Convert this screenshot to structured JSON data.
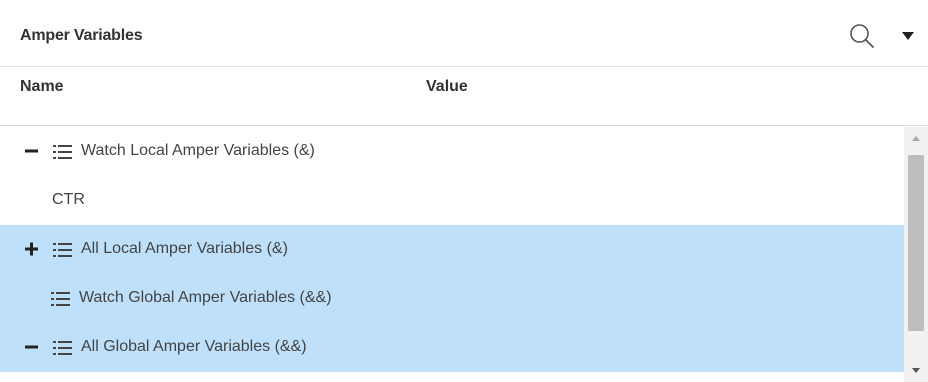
{
  "panel": {
    "title": "Amper Variables",
    "header_icons": [
      "search-icon",
      "dropdown-caret-icon"
    ]
  },
  "columns": {
    "name": "Name",
    "value": "Value"
  },
  "rows": [
    {
      "label": "Watch Local Amper Variables (&)",
      "toggle": "−",
      "icon": "list-icon",
      "selected": false,
      "level": 0
    },
    {
      "label": "CTR",
      "toggle": "",
      "icon": "",
      "selected": false,
      "level": 1
    },
    {
      "label": "All Local Amper Variables (&)",
      "toggle": "+",
      "icon": "list-icon",
      "selected": true,
      "level": 0
    },
    {
      "label": "Watch Global Amper Variables (&&)",
      "toggle": "",
      "icon": "list-icon",
      "selected": true,
      "level": 0
    },
    {
      "label": "All Global Amper Variables (&&)",
      "toggle": "−",
      "icon": "list-icon",
      "selected": true,
      "level": 0
    }
  ],
  "colors": {
    "selected_row": "#bfe0fb",
    "scrollbar_track": "#f1f1f1",
    "scrollbar_thumb": "#bdbdbd"
  }
}
